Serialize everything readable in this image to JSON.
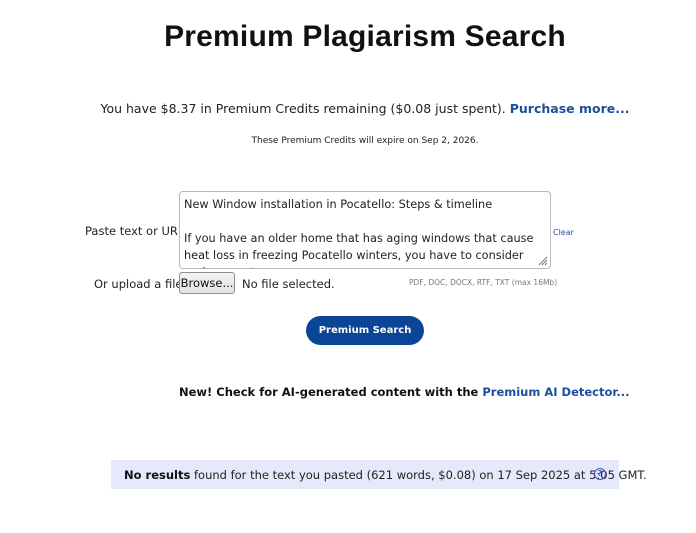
{
  "page": {
    "title": "Premium Plagiarism Search"
  },
  "credits": {
    "text_before": "You have $8.37 in Premium Credits remaining ($0.08 just spent). ",
    "purchase_link": "Purchase more...",
    "expire_text": "These Premium Credits will expire on Sep 2, 2026."
  },
  "form": {
    "paste_label": "Paste text or URL:",
    "textarea_value": "New Window installation in Pocatello: Steps & timeline\n\nIf you have an older home that has aging windows that cause heat loss in freezing Pocatello winters, you have to consider replacement",
    "clear_link": "Clear",
    "upload_label": "Or upload a file:",
    "browse_label": "Browse...",
    "file_status": "No file selected.",
    "formats_note": "PDF, DOC, DOCX, RTF, TXT (max 16Mb)",
    "search_button": "Premium Search"
  },
  "ai_promo": {
    "text": "New! Check for AI-generated content with the ",
    "link": "Premium AI Detector..."
  },
  "result": {
    "bold": "No results",
    "text": " found for the text you pasted (621 words, $0.08) on 17 Sep 2025 at 5:05 GMT.",
    "help_icon": "?"
  },
  "colors": {
    "link": "#1c4f9c",
    "button": "#0a4596",
    "result_bg": "#e6e8fb"
  }
}
